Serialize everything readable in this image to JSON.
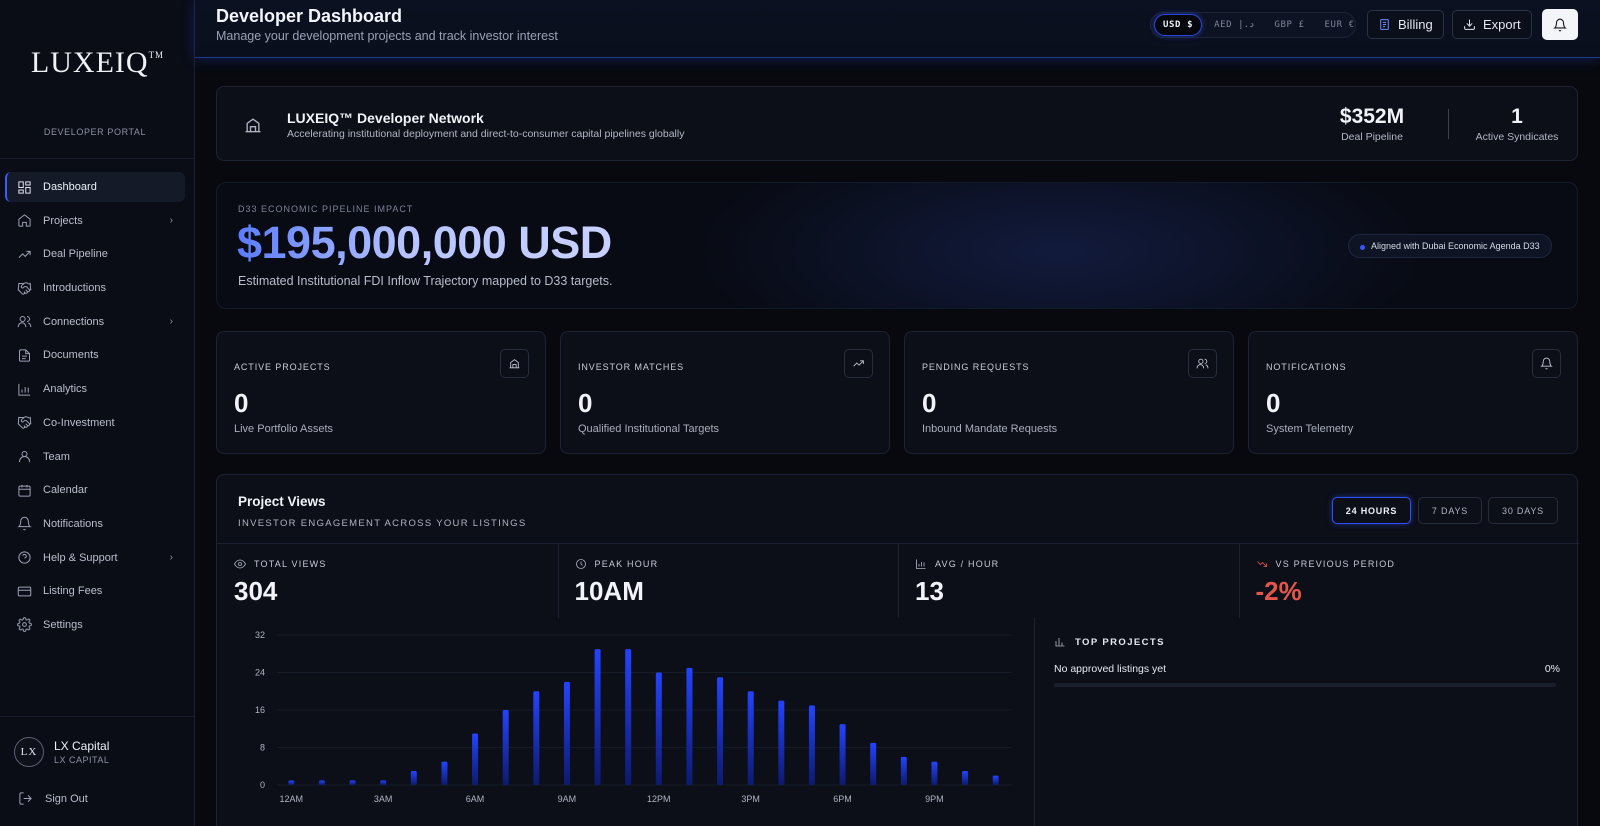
{
  "sidebar": {
    "logo": "LUXEIQ",
    "logo_mark": "TM",
    "portal_label": "DEVELOPER PORTAL",
    "items": [
      {
        "label": "Dashboard",
        "icon": "dashboard-icon",
        "active": true
      },
      {
        "label": "Projects",
        "icon": "home-icon",
        "chevron": true
      },
      {
        "label": "Deal Pipeline",
        "icon": "trending-up-icon"
      },
      {
        "label": "Introductions",
        "icon": "handshake-icon"
      },
      {
        "label": "Connections",
        "icon": "users-icon",
        "chevron": true
      },
      {
        "label": "Documents",
        "icon": "document-icon"
      },
      {
        "label": "Analytics",
        "icon": "bar-chart-icon"
      },
      {
        "label": "Co-Investment",
        "icon": "handshake-icon"
      },
      {
        "label": "Team",
        "icon": "user-icon"
      },
      {
        "label": "Calendar",
        "icon": "calendar-icon"
      },
      {
        "label": "Notifications",
        "icon": "bell-icon"
      },
      {
        "label": "Help & Support",
        "icon": "help-circle-icon",
        "chevron": true
      },
      {
        "label": "Listing Fees",
        "icon": "credit-card-icon"
      },
      {
        "label": "Settings",
        "icon": "gear-icon"
      }
    ],
    "profile": {
      "avatar_text": "LX",
      "name": "LX Capital",
      "sub": "LX CAPITAL"
    },
    "sign_out": "Sign Out"
  },
  "header": {
    "title": "Developer Dashboard",
    "subtitle": "Manage your development projects and track investor interest",
    "currencies": [
      {
        "label": "USD $",
        "active": true
      },
      {
        "label": "AED د.إ",
        "active": false
      },
      {
        "label": "GBP £",
        "active": false
      },
      {
        "label": "EUR €",
        "active": false
      }
    ],
    "billing_label": "Billing",
    "export_label": "Export"
  },
  "network": {
    "title": "LUXEIQ™ Developer Network",
    "subtitle": "Accelerating institutional deployment and direct-to-consumer capital pipelines globally",
    "kpis": [
      {
        "value": "$352M",
        "label": "Deal Pipeline"
      },
      {
        "value": "1",
        "label": "Active Syndicates"
      }
    ]
  },
  "hero": {
    "label": "D33 ECONOMIC PIPELINE IMPACT",
    "value": "$195,000,000 USD",
    "subtitle": "Estimated Institutional FDI Inflow Trajectory mapped to D33 targets.",
    "badge": "Aligned with Dubai Economic Agenda D33"
  },
  "stats": [
    {
      "label": "ACTIVE PROJECTS",
      "value": "0",
      "desc": "Live Portfolio Assets",
      "icon": "building-icon"
    },
    {
      "label": "INVESTOR MATCHES",
      "value": "0",
      "desc": "Qualified Institutional Targets",
      "icon": "trending-up-icon"
    },
    {
      "label": "PENDING REQUESTS",
      "value": "0",
      "desc": "Inbound Mandate Requests",
      "icon": "users-icon"
    },
    {
      "label": "NOTIFICATIONS",
      "value": "0",
      "desc": "System Telemetry",
      "icon": "bell-icon"
    }
  ],
  "project_views": {
    "title": "Project Views",
    "subtitle": "INVESTOR ENGAGEMENT ACROSS YOUR LISTINGS",
    "ranges": [
      {
        "label": "24 HOURS",
        "active": true
      },
      {
        "label": "7 DAYS",
        "active": false
      },
      {
        "label": "30 DAYS",
        "active": false
      }
    ],
    "metrics": [
      {
        "label": "TOTAL VIEWS",
        "value": "304",
        "icon": "eye-icon"
      },
      {
        "label": "PEAK HOUR",
        "value": "10AM",
        "icon": "clock-icon"
      },
      {
        "label": "AVG / HOUR",
        "value": "13",
        "icon": "bar-chart-icon"
      },
      {
        "label": "VS PREVIOUS PERIOD",
        "value": "-2%",
        "icon": "trending-down-icon",
        "color": "#e5564a"
      }
    ],
    "top_projects": {
      "title": "TOP PROJECTS",
      "empty": "No approved listings yet",
      "pct": "0%"
    }
  },
  "chart_data": {
    "type": "bar",
    "categories": [
      "12AM",
      "1AM",
      "2AM",
      "3AM",
      "4AM",
      "5AM",
      "6AM",
      "7AM",
      "8AM",
      "9AM",
      "10AM",
      "11AM",
      "12PM",
      "1PM",
      "2PM",
      "3PM",
      "4PM",
      "5PM",
      "6PM",
      "7PM",
      "8PM",
      "9PM",
      "10PM",
      "11PM"
    ],
    "values": [
      1,
      1,
      1,
      1,
      3,
      5,
      11,
      16,
      20,
      22,
      29,
      29,
      24,
      25,
      23,
      20,
      18,
      17,
      13,
      9,
      6,
      5,
      3,
      2
    ],
    "tick_labels": [
      "12AM",
      "3AM",
      "6AM",
      "9AM",
      "12PM",
      "3PM",
      "6PM",
      "9PM"
    ],
    "y_ticks": [
      0,
      8,
      16,
      24,
      32
    ],
    "ylim": [
      0,
      32
    ],
    "bar_color": "#2443ff",
    "grid": true
  }
}
